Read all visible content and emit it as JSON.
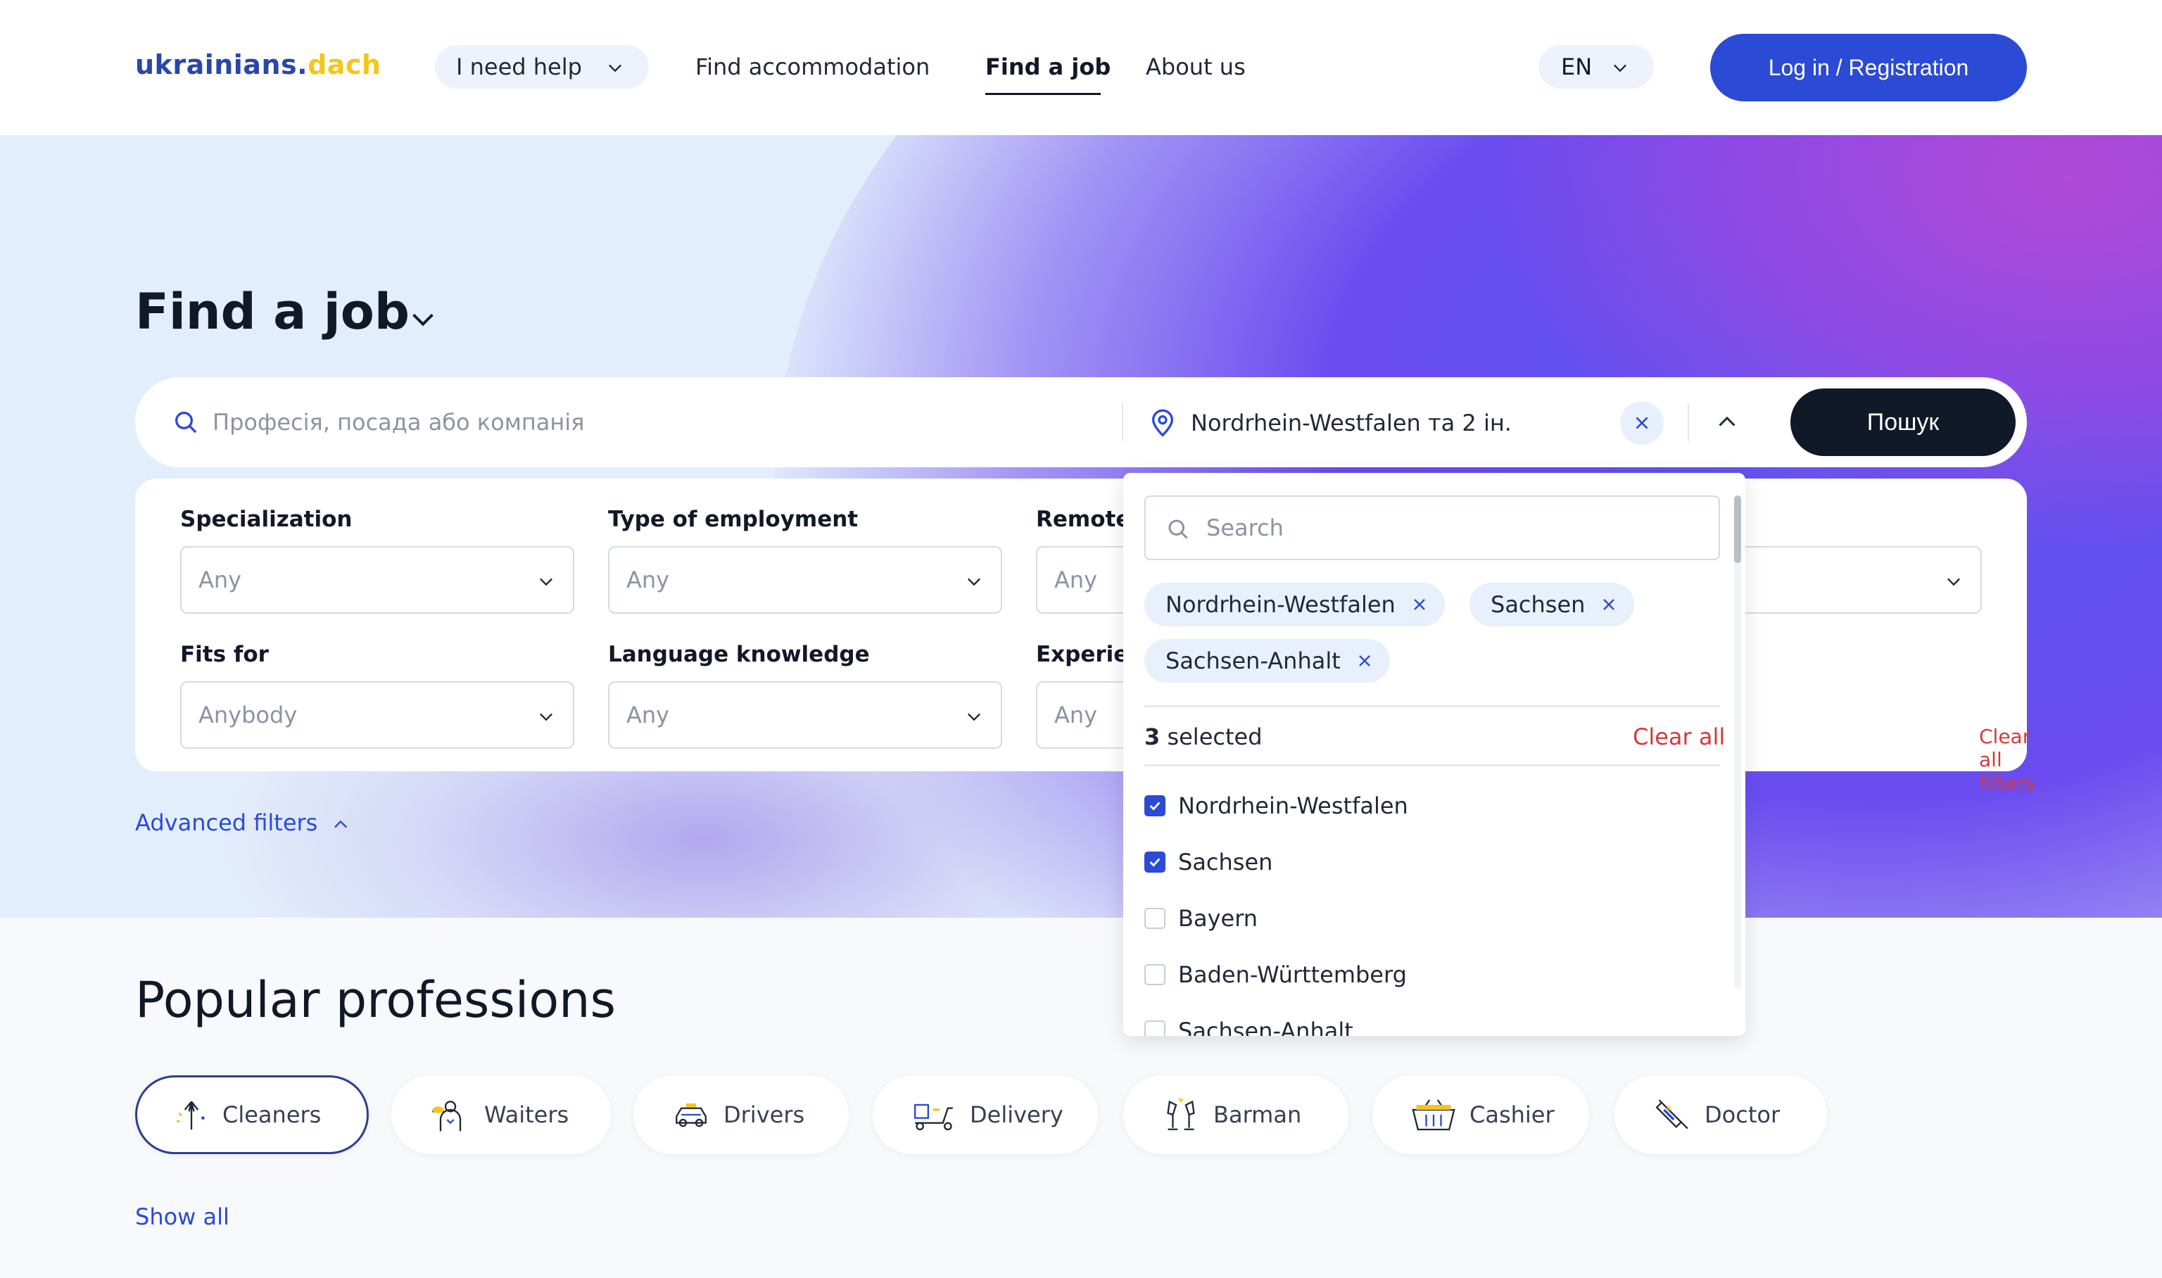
{
  "header": {
    "logo_main": "ukrainians",
    "logo_dot": ".",
    "logo_sub": "dach",
    "help_label": "I need help",
    "nav": [
      "Find accommodation",
      "Find a job",
      "About us"
    ],
    "lang": "EN",
    "login_label": "Log in / Registration"
  },
  "hero": {
    "title": "Find a job",
    "search_placeholder": "Професія, посада або компанія",
    "location_value": "Nordrhein-Westfalen та 2 ін.",
    "search_button": "Пошук"
  },
  "filters": {
    "specialization_label": "Specialization",
    "specialization_value": "Any",
    "employment_label": "Type of employment",
    "employment_value": "Any",
    "remote_label": "Remote",
    "remote_value": "Any",
    "fits_label": "Fits for",
    "fits_value": "Anybody",
    "language_label": "Language knowledge",
    "language_value": "Any",
    "experience_label": "Experie",
    "experience_value": "Any",
    "clear_all_filters": "Clear all filters",
    "advanced_filters": "Advanced filters"
  },
  "dropdown": {
    "search_placeholder": "Search",
    "chips": [
      "Nordrhein-Westfalen",
      "Sachsen",
      "Sachsen-Anhalt"
    ],
    "selected_count": "3",
    "selected_suffix": " selected",
    "clear_all": "Clear all",
    "options": [
      {
        "label": "Nordrhein-Westfalen",
        "checked": true
      },
      {
        "label": "Sachsen",
        "checked": true
      },
      {
        "label": "Bayern",
        "checked": false
      },
      {
        "label": "Baden-Württemberg",
        "checked": false
      },
      {
        "label": "Sachsen-Anhalt",
        "checked": false
      }
    ]
  },
  "popular": {
    "title": "Popular professions",
    "items": [
      {
        "label": "Cleaners",
        "icon": "cleaners-icon",
        "selected": true
      },
      {
        "label": "Waiters",
        "icon": "waiter-icon",
        "selected": false
      },
      {
        "label": "Drivers",
        "icon": "car-icon",
        "selected": false
      },
      {
        "label": "Delivery",
        "icon": "scooter-icon",
        "selected": false
      },
      {
        "label": "Barman",
        "icon": "glasses-icon",
        "selected": false
      },
      {
        "label": "Cashier",
        "icon": "basket-icon",
        "selected": false
      },
      {
        "label": "Doctor",
        "icon": "syringe-icon",
        "selected": false
      }
    ],
    "show_all": "Show all"
  },
  "colors": {
    "brand_blue": "#2b4ad6",
    "logo_yellow": "#f5c518",
    "danger_red": "#d33a3a",
    "dark": "#111827"
  }
}
